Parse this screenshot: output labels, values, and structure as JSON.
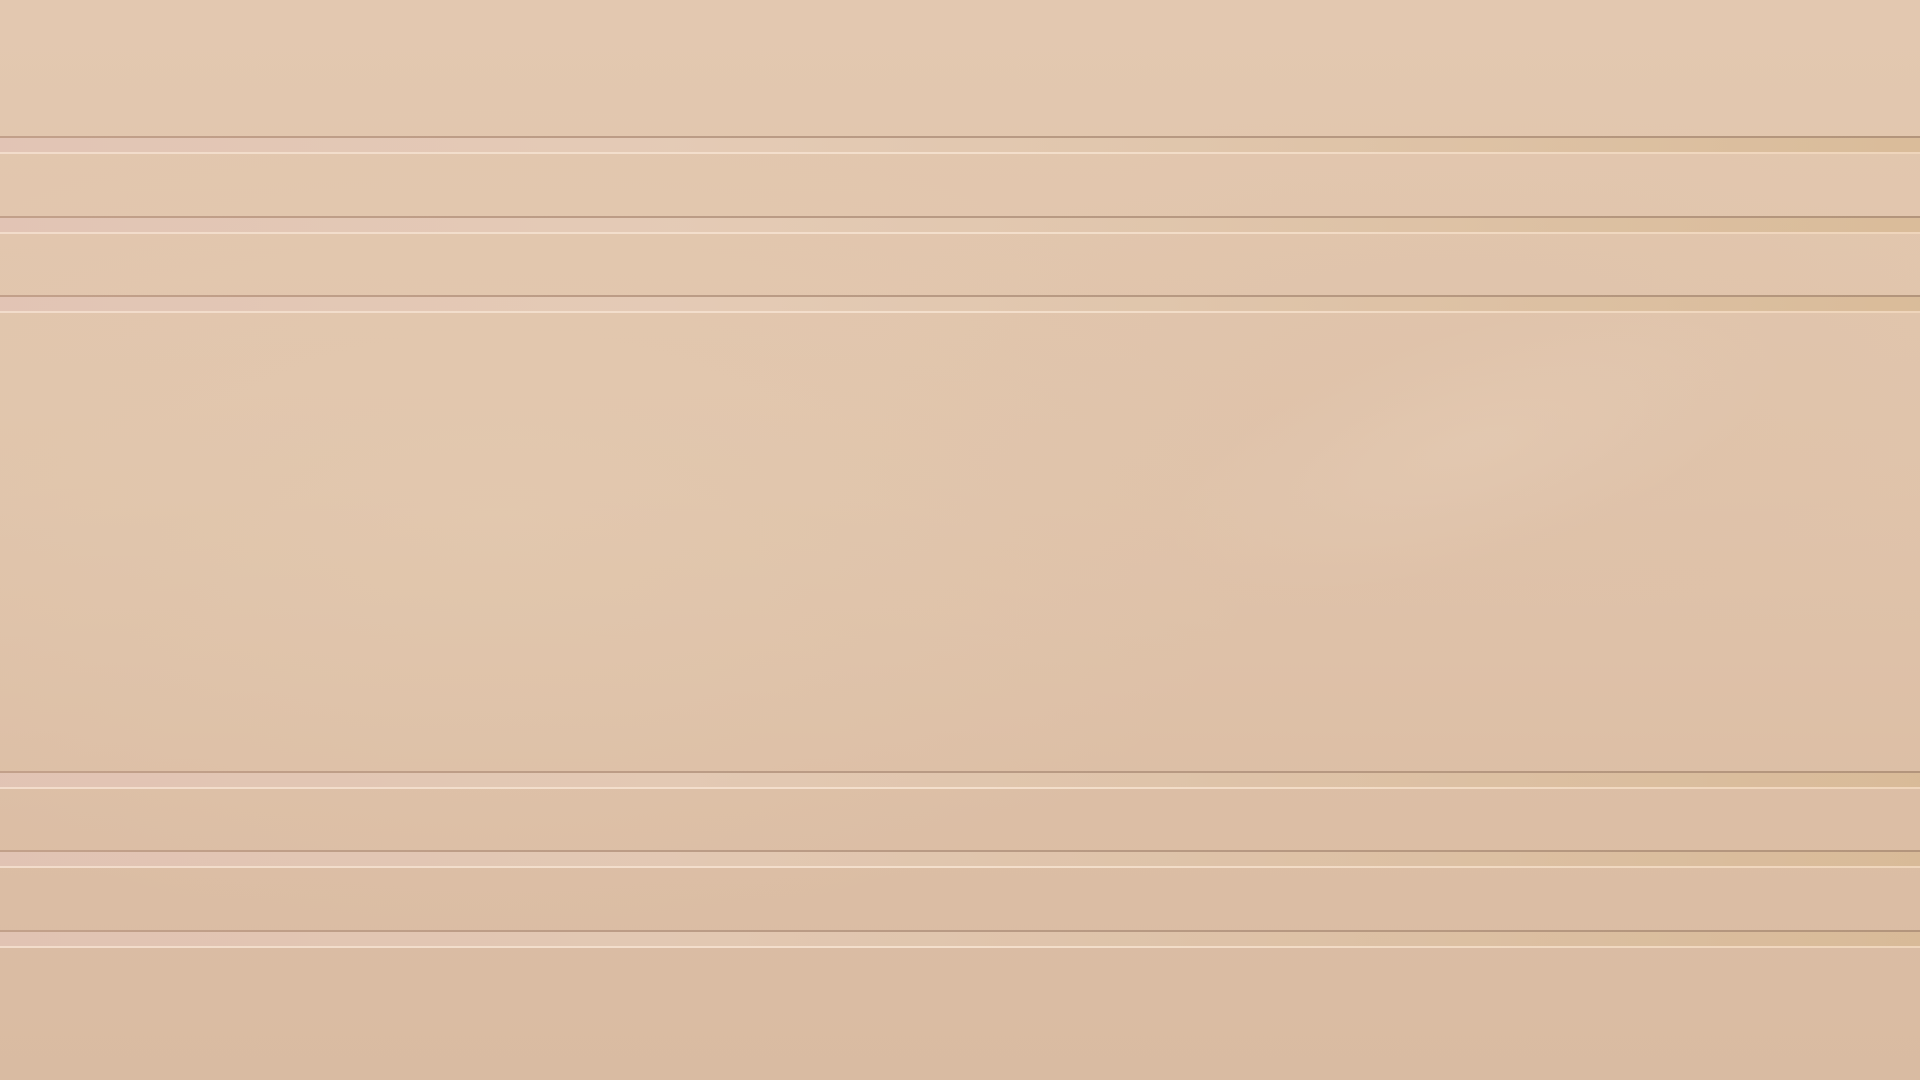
{
  "wallpaper": {
    "style": "horizontal-stripes",
    "colors": {
      "base": "#e0c4ab",
      "stripe_dark_edge": "#b89a84",
      "stripe_light_edge": "#f3dfcc",
      "stripe_tint_right": "#d8ba96"
    },
    "stripe_count": 6
  }
}
